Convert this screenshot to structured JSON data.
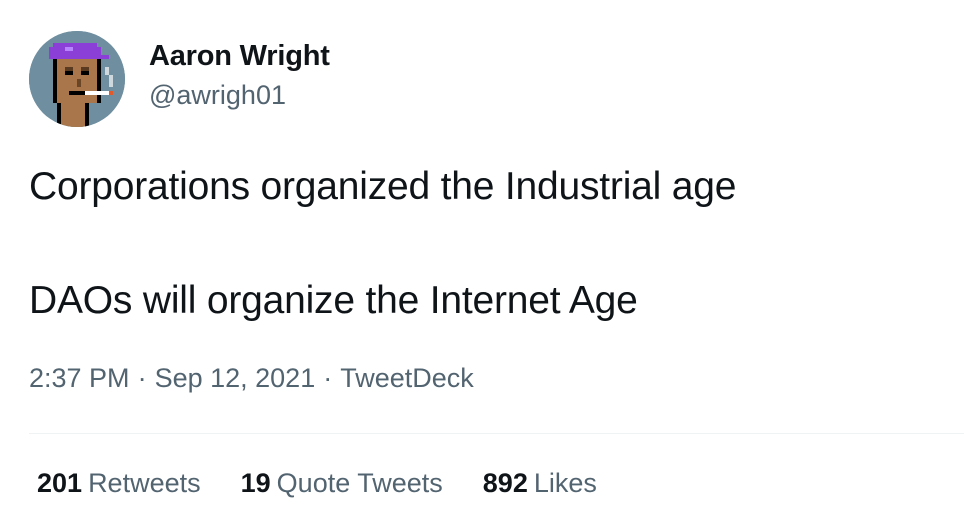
{
  "author": {
    "display_name": "Aaron Wright",
    "handle": "@awrigh01",
    "avatar_icon": "pixel-punk-avatar-icon"
  },
  "tweet": {
    "lines": [
      "Corporations organized the Industrial age",
      "DAOs will organize the Internet Age"
    ]
  },
  "meta": {
    "time": "2:37 PM",
    "separator": "·",
    "date": "Sep 12, 2021",
    "source": "TweetDeck"
  },
  "stats": {
    "retweets_count": "201",
    "retweets_label": "Retweets",
    "quotes_count": "19",
    "quotes_label": "Quote Tweets",
    "likes_count": "892",
    "likes_label": "Likes"
  },
  "colors": {
    "text_primary": "#0f1419",
    "text_secondary": "#536471",
    "divider": "#eff3f4",
    "avatar_background": "#6f8fa0",
    "avatar_cap": "#8b3fd6"
  }
}
